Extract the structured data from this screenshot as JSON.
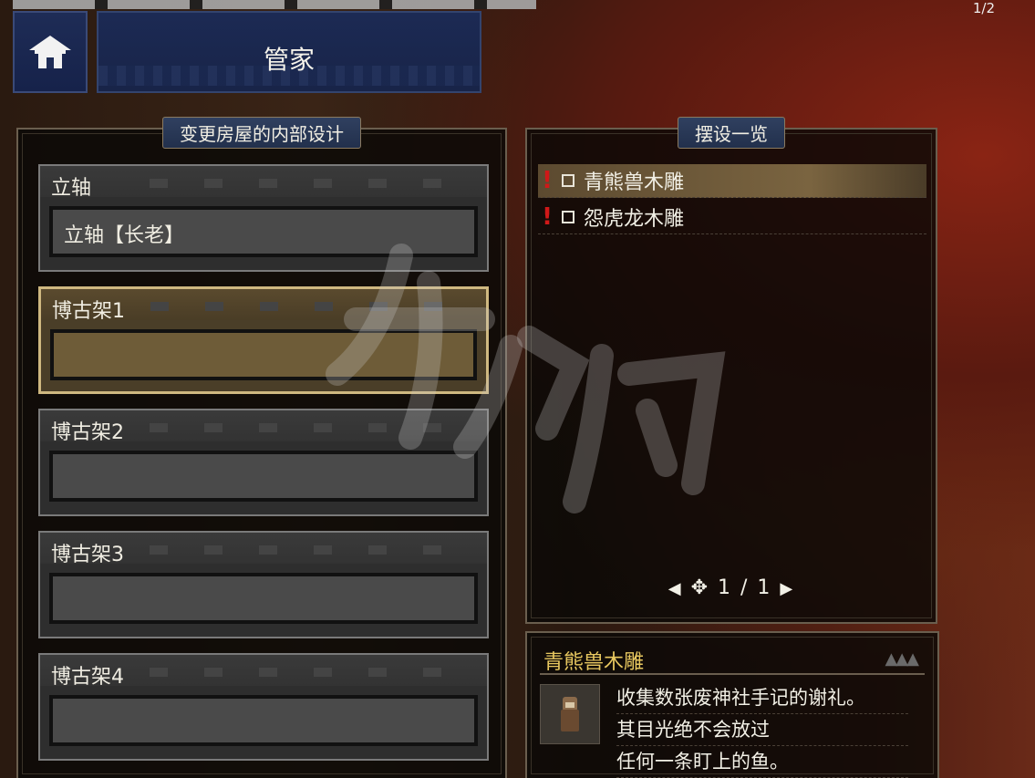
{
  "page_indicator": "1/2",
  "header": {
    "title": "管家",
    "home_icon": "house-icon"
  },
  "design_panel": {
    "title": "变更房屋的内部设计",
    "slots": [
      {
        "label": "立轴",
        "value": "立轴【长老】",
        "selected": false
      },
      {
        "label": "博古架1",
        "value": "",
        "selected": true
      },
      {
        "label": "博古架2",
        "value": "",
        "selected": false
      },
      {
        "label": "博古架3",
        "value": "",
        "selected": false
      },
      {
        "label": "博古架4",
        "value": "",
        "selected": false
      }
    ]
  },
  "placement_panel": {
    "title": "摆设一览",
    "items": [
      {
        "name": "青熊兽木雕",
        "new": true,
        "active": true
      },
      {
        "name": "怨虎龙木雕",
        "new": true,
        "active": false
      }
    ],
    "pager": "1 / 1"
  },
  "description": {
    "title": "青熊兽木雕",
    "lines": [
      "收集数张废神社手记的谢礼。",
      "其目光绝不会放过",
      "任何一条盯上的鱼。"
    ],
    "icon": "figurine-icon"
  },
  "colors": {
    "accent_gold": "#e8c860",
    "new_marker": "#d01818",
    "header_blue": "#1c2a54"
  }
}
